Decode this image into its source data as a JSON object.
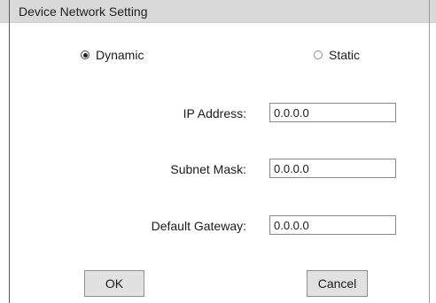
{
  "window": {
    "title": "Device Network Setting"
  },
  "mode": {
    "selected": "Dynamic",
    "options": [
      {
        "label": "Dynamic",
        "checked": true
      },
      {
        "label": "Static",
        "checked": false
      }
    ]
  },
  "fields": {
    "ip_address": {
      "label": "IP Address:",
      "value": "0.0.0.0"
    },
    "subnet_mask": {
      "label": "Subnet Mask:",
      "value": "0.0.0.0"
    },
    "default_gateway": {
      "label": "Default Gateway:",
      "value": "0.0.0.0"
    }
  },
  "buttons": {
    "ok": "OK",
    "cancel": "Cancel"
  }
}
